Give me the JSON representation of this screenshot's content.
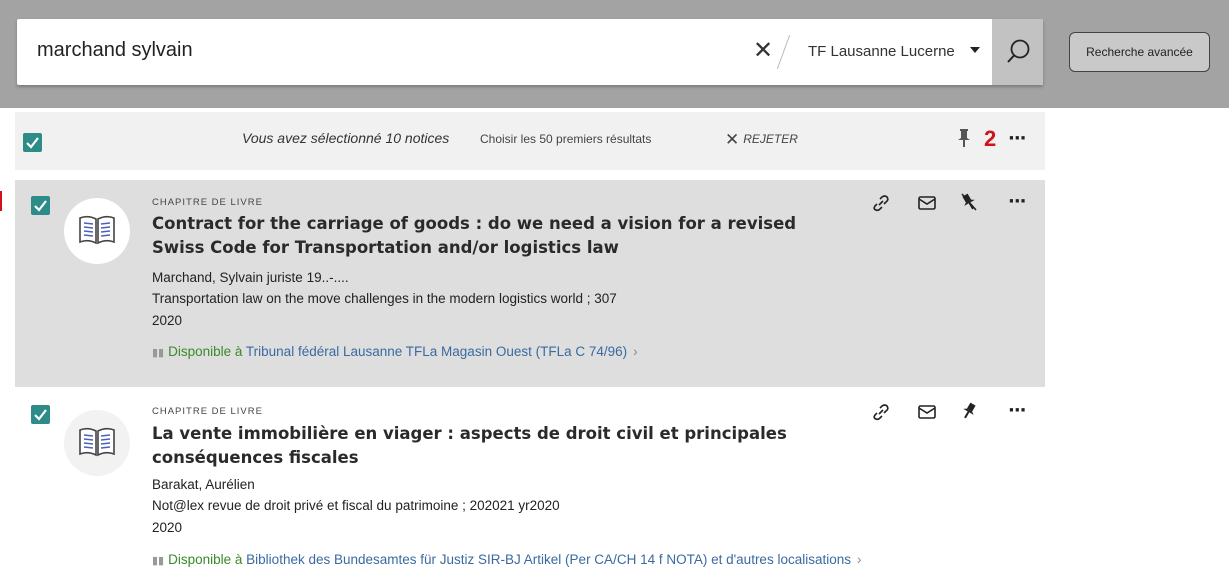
{
  "search": {
    "query": "marchand sylvain",
    "scope": "TF Lausanne Lucerne",
    "advanced_label": "Recherche avancée"
  },
  "selection_bar": {
    "selected_text": "Vous avez sélectionné 10 notices",
    "choose_text": "Choisir les 50 premiers résultats",
    "reject_label": "REJETER",
    "pinned_count": "2"
  },
  "results": [
    {
      "type": "CHAPITRE DE LIVRE",
      "title": "Contract for the carriage of goods : do we need a vision for a revised Swiss Code for Transportation and/or logistics law",
      "author": "Marchand, Sylvain juriste 19..-....",
      "source": "Transportation law on the move challenges in the modern logistics world ; 307",
      "year": "2020",
      "availability_status": "Disponible à",
      "availability_location": "Tribunal fédéral Lausanne  TFLa Magasin Ouest (TFLa C 74/96)",
      "selected": true,
      "pinned": true
    },
    {
      "type": "CHAPITRE DE LIVRE",
      "title": "La vente immobilière en viager : aspects de droit civil et principales conséquences fiscales",
      "author": "Barakat, Aurélien",
      "source": "Not@lex revue de droit privé et fiscal du patrimoine ; 202021 yr2020",
      "year": "2020",
      "availability_status": "Disponible à",
      "availability_location": "Bibliothek des Bundesamtes für Justiz  SIR-BJ Artikel (Per CA/CH 14 f NOTA) et d'autres localisations",
      "selected": true,
      "pinned": false
    }
  ],
  "colors": {
    "accent": "#2e8c88",
    "available": "#3a8a2a",
    "link": "#3a6aa0",
    "highlight": "#d0121b"
  }
}
